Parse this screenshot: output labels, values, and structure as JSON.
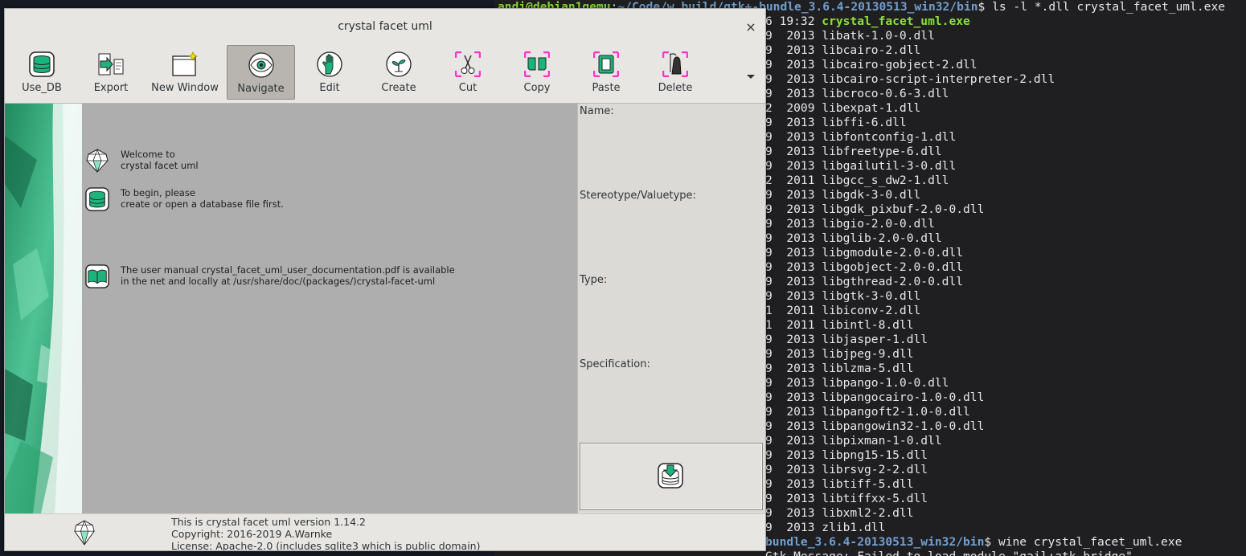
{
  "terminal": {
    "lines": [
      {
        "user": "andi@debian1qemu",
        "path": "~/Code/w_build/gtk+-bundle_3.6.4-20130513_win32/bin",
        "cmd": "$ ls -l *.dll crystal_facet_uml.exe"
      },
      {
        "text": "6 19:32 ",
        "exe": "crystal_facet_uml.exe"
      },
      {
        "text": "9  2013 libatk-1.0-0.dll"
      },
      {
        "text": "9  2013 libcairo-2.dll"
      },
      {
        "text": "9  2013 libcairo-gobject-2.dll"
      },
      {
        "text": "9  2013 libcairo-script-interpreter-2.dll"
      },
      {
        "text": "9  2013 libcroco-0.6-3.dll"
      },
      {
        "text": "2  2009 libexpat-1.dll"
      },
      {
        "text": "9  2013 libffi-6.dll"
      },
      {
        "text": "9  2013 libfontconfig-1.dll"
      },
      {
        "text": "9  2013 libfreetype-6.dll"
      },
      {
        "text": "9  2013 libgailutil-3-0.dll"
      },
      {
        "text": "2  2011 libgcc_s_dw2-1.dll"
      },
      {
        "text": "9  2013 libgdk-3-0.dll"
      },
      {
        "text": "9  2013 libgdk_pixbuf-2.0-0.dll"
      },
      {
        "text": "9  2013 libgio-2.0-0.dll"
      },
      {
        "text": "9  2013 libglib-2.0-0.dll"
      },
      {
        "text": "9  2013 libgmodule-2.0-0.dll"
      },
      {
        "text": "9  2013 libgobject-2.0-0.dll"
      },
      {
        "text": "9  2013 libgthread-2.0-0.dll"
      },
      {
        "text": "9  2013 libgtk-3-0.dll"
      },
      {
        "text": "1  2011 libiconv-2.dll"
      },
      {
        "text": "1  2011 libintl-8.dll"
      },
      {
        "text": "9  2013 libjasper-1.dll"
      },
      {
        "text": "9  2013 libjpeg-9.dll"
      },
      {
        "text": "9  2013 liblzma-5.dll"
      },
      {
        "text": "9  2013 libpango-1.0-0.dll"
      },
      {
        "text": "9  2013 libpangocairo-1.0-0.dll"
      },
      {
        "text": "9  2013 libpangoft2-1.0-0.dll"
      },
      {
        "text": "9  2013 libpangowin32-1.0-0.dll"
      },
      {
        "text": "9  2013 libpixman-1-0.dll"
      },
      {
        "text": "9  2013 libpng15-15.dll"
      },
      {
        "text": "9  2013 librsvg-2-2.dll"
      },
      {
        "text": "9  2013 libtiff-5.dll"
      },
      {
        "text": "9  2013 libtiffxx-5.dll"
      },
      {
        "text": "9  2013 libxml2-2.dll"
      },
      {
        "text": "9  2013 zlib1.dll"
      },
      {
        "path": "bundle_3.6.4-20130513_win32/bin",
        "cmd": "$ wine crystal_facet_uml.exe"
      },
      {
        "text": "Gtk-Message: Failed to load module \"gail:atk-bridge\""
      }
    ],
    "colors": {
      "user": "#8ae234",
      "path": "#729fcf",
      "exe": "#8ae234",
      "text": "#e8e8e8"
    }
  },
  "window": {
    "title": "crystal facet uml",
    "close_glyph": "×",
    "toolbar": [
      {
        "name": "use-db-button",
        "label": "Use_DB",
        "icon": "database-icon"
      },
      {
        "name": "export-button",
        "label": "Export",
        "icon": "export-icon"
      },
      {
        "name": "new-window-button",
        "label": "New Window",
        "icon": "new-window-icon"
      },
      {
        "name": "navigate-button",
        "label": "Navigate",
        "icon": "eye-icon",
        "active": true
      },
      {
        "name": "edit-button",
        "label": "Edit",
        "icon": "hand-icon"
      },
      {
        "name": "create-button",
        "label": "Create",
        "icon": "sprout-icon"
      },
      {
        "name": "cut-button",
        "label": "Cut",
        "icon": "scissors-icon"
      },
      {
        "name": "copy-button",
        "label": "Copy",
        "icon": "copy-icon"
      },
      {
        "name": "paste-button",
        "label": "Paste",
        "icon": "paste-icon"
      },
      {
        "name": "delete-button",
        "label": "Delete",
        "icon": "grim-reaper-icon"
      }
    ],
    "messages": [
      {
        "icon": "crystal-icon",
        "line1": "Welcome to",
        "line2": "crystal facet uml"
      },
      {
        "icon": "database-icon",
        "line1": "To begin, please",
        "line2": "create or open a database file first."
      },
      {
        "icon": "book-icon",
        "line1": "The user manual crystal_facet_uml_user_documentation.pdf is available",
        "line2": "in the net and locally at /usr/share/doc/(packages/)crystal-facet-uml"
      }
    ],
    "attributes": {
      "name_label": "Name:",
      "stereotype_label": "Stereotype/Valuetype:",
      "type_label": "Type:",
      "specification_label": "Specification:"
    },
    "status": {
      "line1": "This is crystal facet uml version 1.14.2",
      "line2": "Copyright: 2016-2019 A.Warnke",
      "line3": "License: Apache-2.0 (includes sqlite3 which is public domain)"
    },
    "accent_color": "#13a371",
    "highlight_color": "#ff33cc"
  }
}
